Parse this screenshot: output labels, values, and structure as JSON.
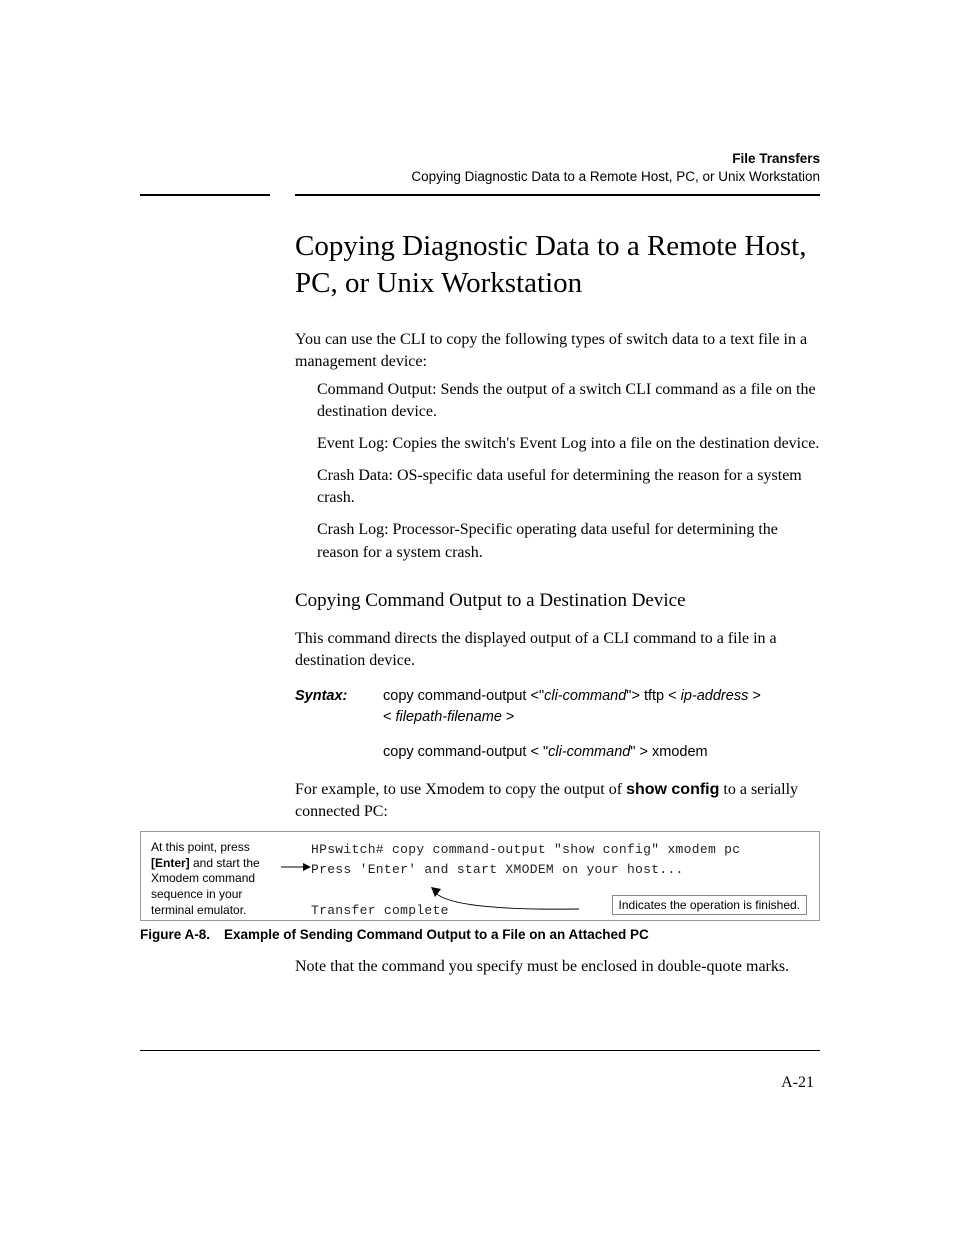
{
  "header": {
    "line1": "File Transfers",
    "line2": "Copying Diagnostic Data to a Remote Host, PC, or Unix Workstation"
  },
  "title": "Copying Diagnostic Data to a Remote Host, PC, or Unix Workstation",
  "intro": "You can use the CLI to copy the following types of switch data to a text file in a management device:",
  "bullets": {
    "b1": "Command Output: Sends the output of a switch CLI command as a file on the destination device.",
    "b2": "Event Log: Copies the switch's Event Log into a file on the destination device.",
    "b3": "Crash Data: OS-specific data useful for determining the reason for a system crash.",
    "b4": "Crash Log: Processor-Specific operating data useful for determining the reason for a system crash."
  },
  "subhead": "Copying Command Output to a Destination Device",
  "subintro": "This command directs the displayed output of a CLI command to a file in a destination device.",
  "syntax": {
    "label": "Syntax:",
    "line1_pre": "copy command-output <\"",
    "line1_ital1": "cli-command",
    "line1_mid": "\"> tftp < ",
    "line1_ital2": "ip-address",
    "line1_post": " >",
    "line2_pre": "< ",
    "line2_ital": "filepath-filename",
    "line2_post": " >",
    "line3_pre": "copy command-output < \"",
    "line3_ital": "cli-command",
    "line3_post": "\" > xmodem"
  },
  "example_lead_pre": "For example, to use Xmodem to copy the output of ",
  "example_cmd": "show config",
  "example_lead_post": " to a serially connected PC:",
  "figure": {
    "callout_left_pre": "At this point, press ",
    "callout_left_key": "[Enter]",
    "callout_left_post": " and start the Xmodem command sequence in your terminal emulator.",
    "terminal_l1": "HPswitch# copy command-output \"show config\" xmodem pc",
    "terminal_l2": "Press 'Enter' and start XMODEM on your host...",
    "terminal_l3": "Transfer complete",
    "callout_right": "Indicates the operation is finished."
  },
  "figure_caption_num": "Figure A-8.",
  "figure_caption_text": "Example of Sending Command Output to a File on an Attached PC",
  "note": "Note that the command you specify must be enclosed in double-quote marks.",
  "page_number": "A-21"
}
